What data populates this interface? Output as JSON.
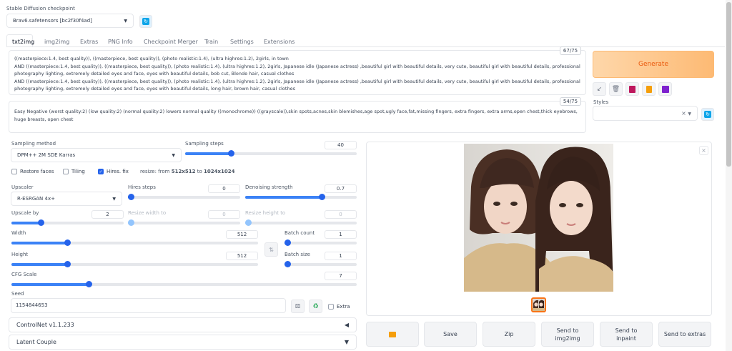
{
  "checkpoint": {
    "label": "Stable Diffusion checkpoint",
    "value": "Brav6.safetensors [bc2f30f4ad]"
  },
  "tabs": [
    "txt2img",
    "img2img",
    "Extras",
    "PNG Info",
    "Checkpoint Merger",
    "Train",
    "Settings",
    "Extensions"
  ],
  "prompt": {
    "text": "((masterpiece:1.4, best quality)), ((masterpiece, best quality)), (photo realistic:1.4), (ultra highres:1.2), 2girls, in town\nAND ((masterpiece:1.4, best quality)), ((masterpiece, best quality)), (photo realistic:1.4), (ultra highres:1.2), 2girls, Japanese idle (Japanese actress) ,beautiful girl with beautiful details, very cute, beautiful girl with beautiful details, professional photography lighting, extremely detailed eyes and face, eyes with beautiful details, bob cut, Blonde hair, casual clothes\nAND ((masterpiece:1.4, best quality)), ((masterpiece, best quality)), (photo realistic:1.4), (ultra highres:1.2), 2girls, Japanese idle (Japanese actress) ,beautiful girl with beautiful details, very cute, beautiful girl with beautiful details, professional photography lighting, extremely detailed eyes and face, eyes with beautiful details, long hair, brown hair, casual clothes",
    "token_count": "67/75"
  },
  "negative_prompt": {
    "text": "Easy Negative (worst quality:2) (low quality:2) (normal quality:2) lowers normal quality ((monochrome)) ((grayscale)),skin spots,acnes,skin blemishes,age spot,ugly face,fat,missing fingers, extra fingers, extra arms,open chest,thick eyebrows, huge breasts, open chest",
    "token_count": "54/75"
  },
  "generate_label": "Generate",
  "styles_label": "Styles",
  "sampling": {
    "method_label": "Sampling method",
    "method_value": "DPM++ 2M SDE Karras",
    "steps_label": "Sampling steps",
    "steps_value": "40"
  },
  "checks": {
    "restore_faces": "Restore faces",
    "tiling": "Tiling",
    "hires_fix": "Hires. fix",
    "resize_prefix": "resize: from",
    "resize_from": "512x512",
    "resize_to_word": "to",
    "resize_to": "1024x1024"
  },
  "upscaler": {
    "label": "Upscaler",
    "value": "R-ESRGAN 4x+"
  },
  "hires_steps": {
    "label": "Hires steps",
    "value": "0"
  },
  "denoising": {
    "label": "Denoising strength",
    "value": "0.7"
  },
  "upscale_by": {
    "label": "Upscale by",
    "value": "2"
  },
  "resize_width": {
    "label": "Resize width to",
    "value": "0"
  },
  "resize_height": {
    "label": "Resize height to",
    "value": "0"
  },
  "width": {
    "label": "Width",
    "value": "512"
  },
  "height": {
    "label": "Height",
    "value": "512"
  },
  "batch_count": {
    "label": "Batch count",
    "value": "1"
  },
  "batch_size": {
    "label": "Batch size",
    "value": "1"
  },
  "cfg": {
    "label": "CFG Scale",
    "value": "7"
  },
  "seed": {
    "label": "Seed",
    "value": "1154844653",
    "extra_label": "Extra"
  },
  "accordions": {
    "controlnet": "ControlNet v1.1.233",
    "latent": "Latent Couple"
  },
  "output_buttons": {
    "folder": "",
    "save": "Save",
    "zip": "Zip",
    "send_img2img": "Send to img2img",
    "send_inpaint": "Send to inpaint",
    "send_extras": "Send to extras"
  },
  "slider_levels": {
    "sampling_steps": 0.26,
    "hires_steps": 0.0,
    "denoising": 0.7,
    "upscale_by": 0.25,
    "resize_width": 0.0,
    "resize_height": 0.0,
    "width": 0.22,
    "height": 0.22,
    "batch_count": 0.0,
    "batch_size": 0.0,
    "cfg": 0.22
  },
  "colors": {
    "accent": "#3b82f6",
    "generate_orange": "#f97316"
  }
}
